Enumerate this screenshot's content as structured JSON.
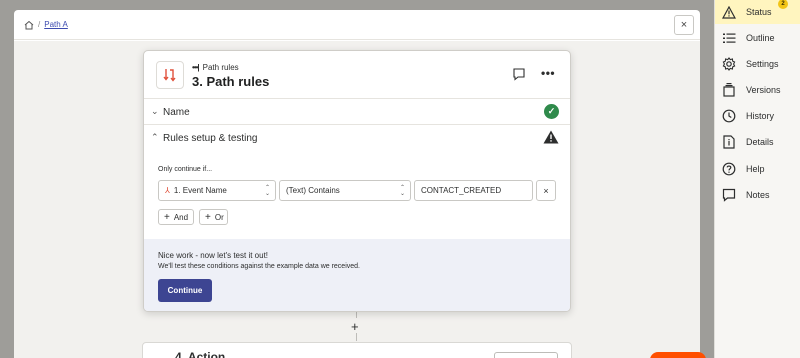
{
  "breadcrumb": {
    "current": "Path A",
    "separator": "/"
  },
  "step": {
    "kind": "Path rules",
    "title": "3. Path rules"
  },
  "sections": {
    "name_label": "Name",
    "rules_label": "Rules setup & testing"
  },
  "rules": {
    "only_label": "Only continue if...",
    "field": "1. Event Name",
    "condition": "(Text) Contains",
    "value": "CONTACT_CREATED",
    "remove_label": "×",
    "and_label": "And",
    "or_label": "Or"
  },
  "test": {
    "title": "Nice work - now let's test it out!",
    "description": "We'll test these conditions against the example data we received.",
    "continue_label": "Continue"
  },
  "next_step": {
    "title": "4. Action"
  },
  "canvas": {
    "add_label": "+"
  },
  "sidebar": {
    "status_badge": "2",
    "items": [
      {
        "label": "Status",
        "icon": "warning-icon"
      },
      {
        "label": "Outline",
        "icon": "list-icon"
      },
      {
        "label": "Settings",
        "icon": "gear-icon"
      },
      {
        "label": "Versions",
        "icon": "versions-icon"
      },
      {
        "label": "History",
        "icon": "clock-icon"
      },
      {
        "label": "Details",
        "icon": "document-icon"
      },
      {
        "label": "Help",
        "icon": "help-icon"
      },
      {
        "label": "Notes",
        "icon": "note-icon"
      }
    ]
  },
  "colors": {
    "accent": "#3d4592",
    "brand": "#ff4f00",
    "success": "#2f8a4b",
    "status_highlight": "#fff5bf"
  }
}
